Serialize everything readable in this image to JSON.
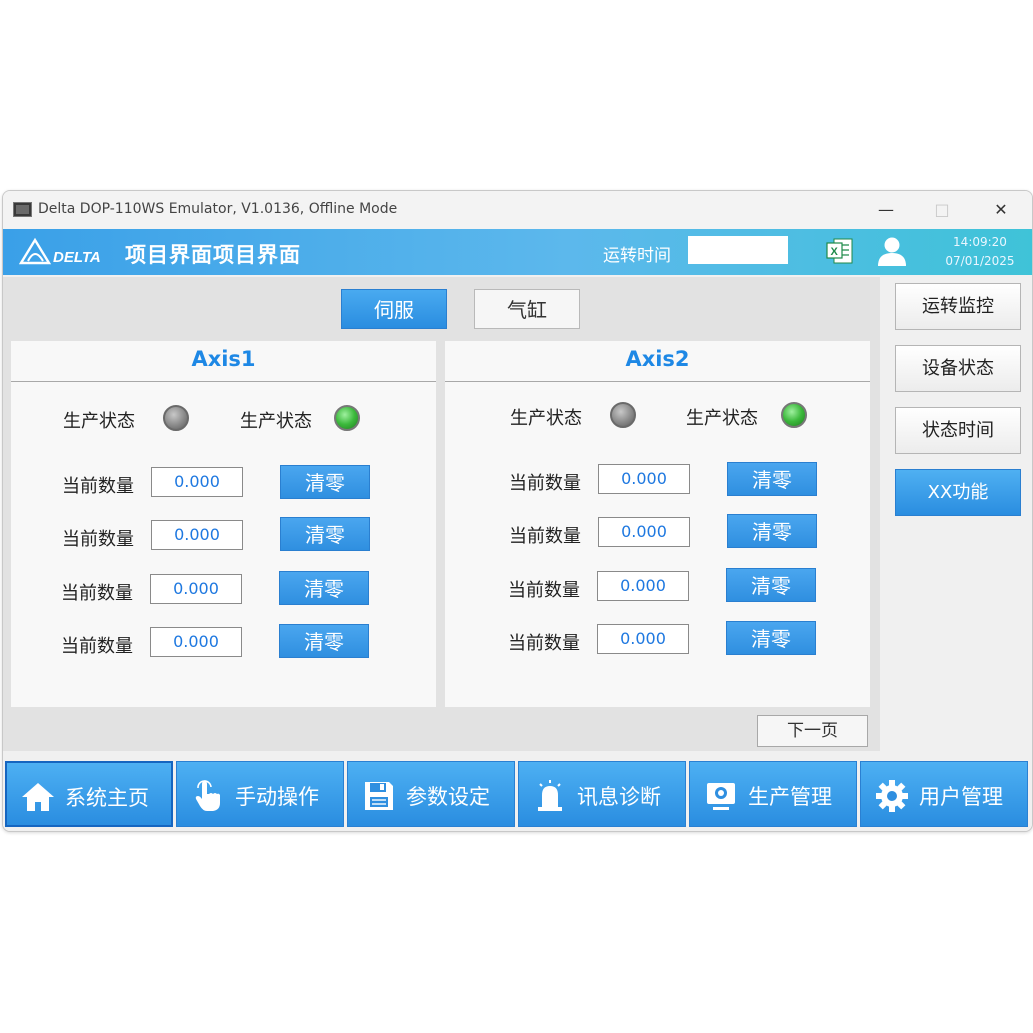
{
  "window": {
    "title": "Delta DOP-110WS Emulator, V1.0136, Offline Mode",
    "min_glyph": "—",
    "max_glyph": "□",
    "close_glyph": "✕"
  },
  "header": {
    "logo_text": "DELTA",
    "project_title": "项目界面项目界面",
    "runtime_label": "运转时间",
    "runtime_value": "",
    "time": "14:09:20",
    "date": "07/01/2025"
  },
  "tabs": [
    {
      "label": "伺服",
      "active": true
    },
    {
      "label": "气缸",
      "active": false
    }
  ],
  "axes": [
    {
      "title": "Axis1",
      "status": [
        {
          "label": "生产状态",
          "led": "gray"
        },
        {
          "label": "生产状态",
          "led": "green"
        }
      ],
      "rows": [
        {
          "label": "当前数量",
          "value": "0.000",
          "button": "清零"
        },
        {
          "label": "当前数量",
          "value": "0.000",
          "button": "清零"
        },
        {
          "label": "当前数量",
          "value": "0.000",
          "button": "清零"
        },
        {
          "label": "当前数量",
          "value": "0.000",
          "button": "清零"
        }
      ]
    },
    {
      "title": "Axis2",
      "status": [
        {
          "label": "生产状态",
          "led": "gray"
        },
        {
          "label": "生产状态",
          "led": "green"
        }
      ],
      "rows": [
        {
          "label": "当前数量",
          "value": "0.000",
          "button": "清零"
        },
        {
          "label": "当前数量",
          "value": "0.000",
          "button": "清零"
        },
        {
          "label": "当前数量",
          "value": "0.000",
          "button": "清零"
        },
        {
          "label": "当前数量",
          "value": "0.000",
          "button": "清零"
        }
      ]
    }
  ],
  "next_page": "下一页",
  "sidebar": [
    {
      "label": "运转监控",
      "active": false
    },
    {
      "label": "设备状态",
      "active": false
    },
    {
      "label": "状态时间",
      "active": false
    },
    {
      "label": "XX功能",
      "active": true
    }
  ],
  "bottom_nav": [
    {
      "label": "系统主页",
      "icon": "home-icon",
      "active": true
    },
    {
      "label": "手动操作",
      "icon": "hand-pointer-icon",
      "active": false
    },
    {
      "label": "参数设定",
      "icon": "save-disk-icon",
      "active": false
    },
    {
      "label": "讯息诊断",
      "icon": "alarm-bell-icon",
      "active": false
    },
    {
      "label": "生产管理",
      "icon": "monitor-icon",
      "active": false
    },
    {
      "label": "用户管理",
      "icon": "gear-icon",
      "active": false
    }
  ],
  "colors": {
    "accent": "#2a8de0",
    "header_start": "#3aa0e8",
    "header_end": "#3fc3d8",
    "axis_title": "#1e88e5",
    "value_text": "#1e78e0",
    "led_gray": "#8a8a8a",
    "led_green": "#3cb93c"
  }
}
